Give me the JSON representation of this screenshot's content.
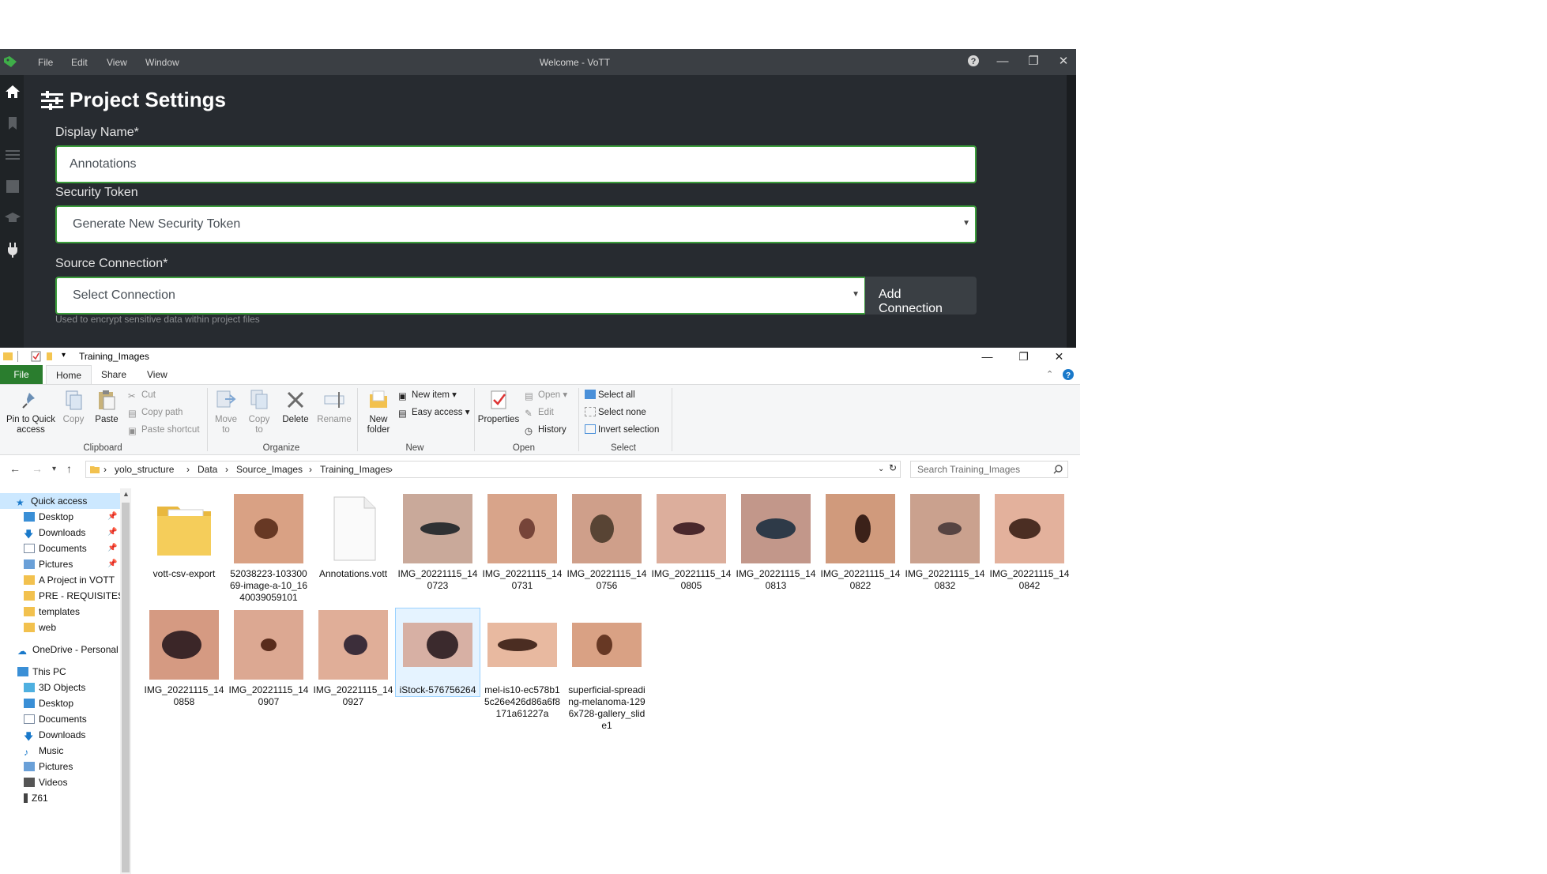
{
  "vott": {
    "menu": [
      "File",
      "Edit",
      "View",
      "Window"
    ],
    "window_title": "Welcome - VoTT",
    "page_heading": "Project Settings",
    "display_name_label": "Display Name*",
    "display_name_value": "Annotations",
    "security_token_label": "Security Token",
    "security_token_value": "Generate New Security Token",
    "security_token_hint": "Used to encrypt sensitive data within project files",
    "source_connection_label": "Source Connection*",
    "source_connection_value": "Select Connection",
    "add_connection_label": "Add Connection",
    "accent_color": "#3c9e3c"
  },
  "explorer": {
    "window_title": "Training_Images",
    "tabs": [
      "File",
      "Home",
      "Share",
      "View"
    ],
    "ribbon": {
      "clipboard": {
        "pin": "Pin to Quick access",
        "copy": "Copy",
        "paste": "Paste",
        "cut": "Cut",
        "copy_path": "Copy path",
        "paste_shortcut": "Paste shortcut",
        "group": "Clipboard"
      },
      "organize": {
        "move_to": "Move to",
        "copy_to": "Copy to",
        "delete": "Delete",
        "rename": "Rename",
        "group": "Organize"
      },
      "new": {
        "new_folder": "New folder",
        "new_item": "New item",
        "easy_access": "Easy access",
        "group": "New"
      },
      "open": {
        "properties": "Properties",
        "open": "Open",
        "edit": "Edit",
        "history": "History",
        "group": "Open"
      },
      "select": {
        "select_all": "Select all",
        "select_none": "Select none",
        "invert": "Invert selection",
        "group": "Select"
      }
    },
    "breadcrumb": [
      "yolo_structure",
      "Data",
      "Source_Images",
      "Training_Images"
    ],
    "search_placeholder": "Search Training_Images",
    "nav": {
      "quick_access": "Quick access",
      "quick_items": [
        "Desktop",
        "Downloads",
        "Documents",
        "Pictures",
        "A Project in VOTT",
        "PRE - REQUISITES",
        "templates",
        "web"
      ],
      "onedrive": "OneDrive - Personal",
      "this_pc": "This PC",
      "pc_items": [
        "3D Objects",
        "Desktop",
        "Documents",
        "Downloads",
        "Music",
        "Pictures",
        "Videos",
        "Z61"
      ]
    },
    "files": [
      {
        "name": "vott-csv-export",
        "kind": "folder"
      },
      {
        "name": "52038223-10330069-image-a-10_1640039059101",
        "kind": "image"
      },
      {
        "name": "Annotations.vott",
        "kind": "doc"
      },
      {
        "name": "IMG_20221115_140723",
        "kind": "image"
      },
      {
        "name": "IMG_20221115_140731",
        "kind": "image"
      },
      {
        "name": "IMG_20221115_140756",
        "kind": "image"
      },
      {
        "name": "IMG_20221115_140805",
        "kind": "image"
      },
      {
        "name": "IMG_20221115_140813",
        "kind": "image"
      },
      {
        "name": "IMG_20221115_140822",
        "kind": "image"
      },
      {
        "name": "IMG_20221115_140832",
        "kind": "image"
      },
      {
        "name": "IMG_20221115_140842",
        "kind": "image"
      },
      {
        "name": "IMG_20221115_140858",
        "kind": "image"
      },
      {
        "name": "IMG_20221115_140907",
        "kind": "image"
      },
      {
        "name": "IMG_20221115_140927",
        "kind": "image"
      },
      {
        "name": "iStock-576756264",
        "kind": "image",
        "selected": true
      },
      {
        "name": "mel-is10-ec578b15c26e426d86a6f8171a61227a",
        "kind": "image"
      },
      {
        "name": "superficial-spreading-melanoma-1296x728-gallery_slide1",
        "kind": "image"
      }
    ]
  }
}
